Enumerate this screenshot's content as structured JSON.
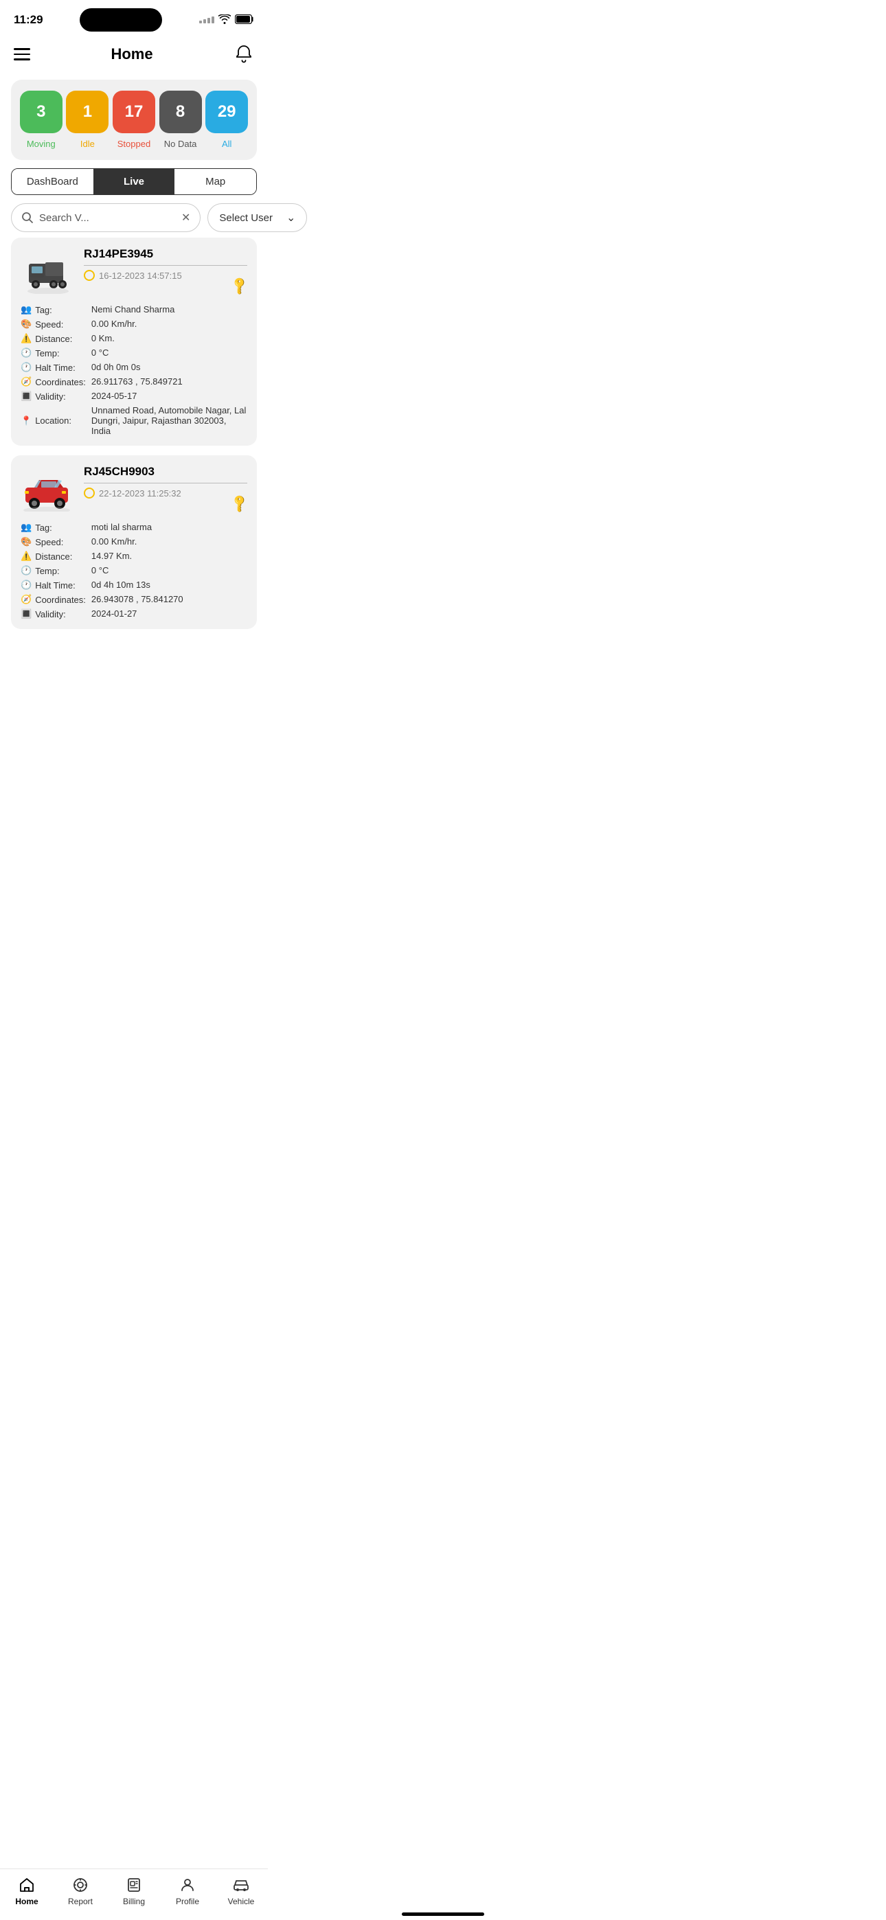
{
  "statusBar": {
    "time": "11:29"
  },
  "header": {
    "title": "Home"
  },
  "stats": [
    {
      "value": "3",
      "label": "Moving",
      "color": "#4cbb5a"
    },
    {
      "value": "1",
      "label": "Idle",
      "color": "#f0a800"
    },
    {
      "value": "17",
      "label": "Stopped",
      "color": "#e8503a"
    },
    {
      "value": "8",
      "label": "No Data",
      "color": "#555"
    },
    {
      "value": "29",
      "label": "All",
      "color": "#29abe2"
    }
  ],
  "tabs": [
    {
      "label": "DashBoard",
      "active": false
    },
    {
      "label": "Live",
      "active": true
    },
    {
      "label": "Map",
      "active": false
    }
  ],
  "search": {
    "placeholder": "Search V...",
    "selectUser": "Select User"
  },
  "vehicles": [
    {
      "plate": "RJ14PE3945",
      "time": "16-12-2023 14:57:15",
      "tag": "Nemi Chand Sharma",
      "speed": "0.00 Km/hr.",
      "distance": "0 Km.",
      "temp": "0 °C",
      "haltTime": "0d 0h 0m 0s",
      "coordinates": "26.911763 , 75.849721",
      "validity": "2024-05-17",
      "location": "Unnamed Road, Automobile Nagar, Lal Dungri, Jaipur, Rajasthan 302003, India",
      "type": "truck"
    },
    {
      "plate": "RJ45CH9903",
      "time": "22-12-2023 11:25:32",
      "tag": "moti lal sharma",
      "speed": "0.00 Km/hr.",
      "distance": "14.97 Km.",
      "temp": "0 °C",
      "haltTime": "0d 4h 10m 13s",
      "coordinates": "26.943078 , 75.841270",
      "validity": "2024-01-27",
      "location": "",
      "type": "car"
    }
  ],
  "bottomNav": [
    {
      "label": "Home",
      "icon": "home",
      "active": true
    },
    {
      "label": "Report",
      "icon": "report",
      "active": false
    },
    {
      "label": "Billing",
      "icon": "billing",
      "active": false
    },
    {
      "label": "Profile",
      "icon": "profile",
      "active": false
    },
    {
      "label": "Vehicle",
      "icon": "vehicle",
      "active": false
    }
  ],
  "detailKeys": {
    "tag": "Tag:",
    "speed": "Speed:",
    "distance": "Distance:",
    "temp": "Temp:",
    "haltTime": "Halt Time:",
    "coordinates": "Coordinates:",
    "validity": "Validity:",
    "location": "Location:"
  }
}
